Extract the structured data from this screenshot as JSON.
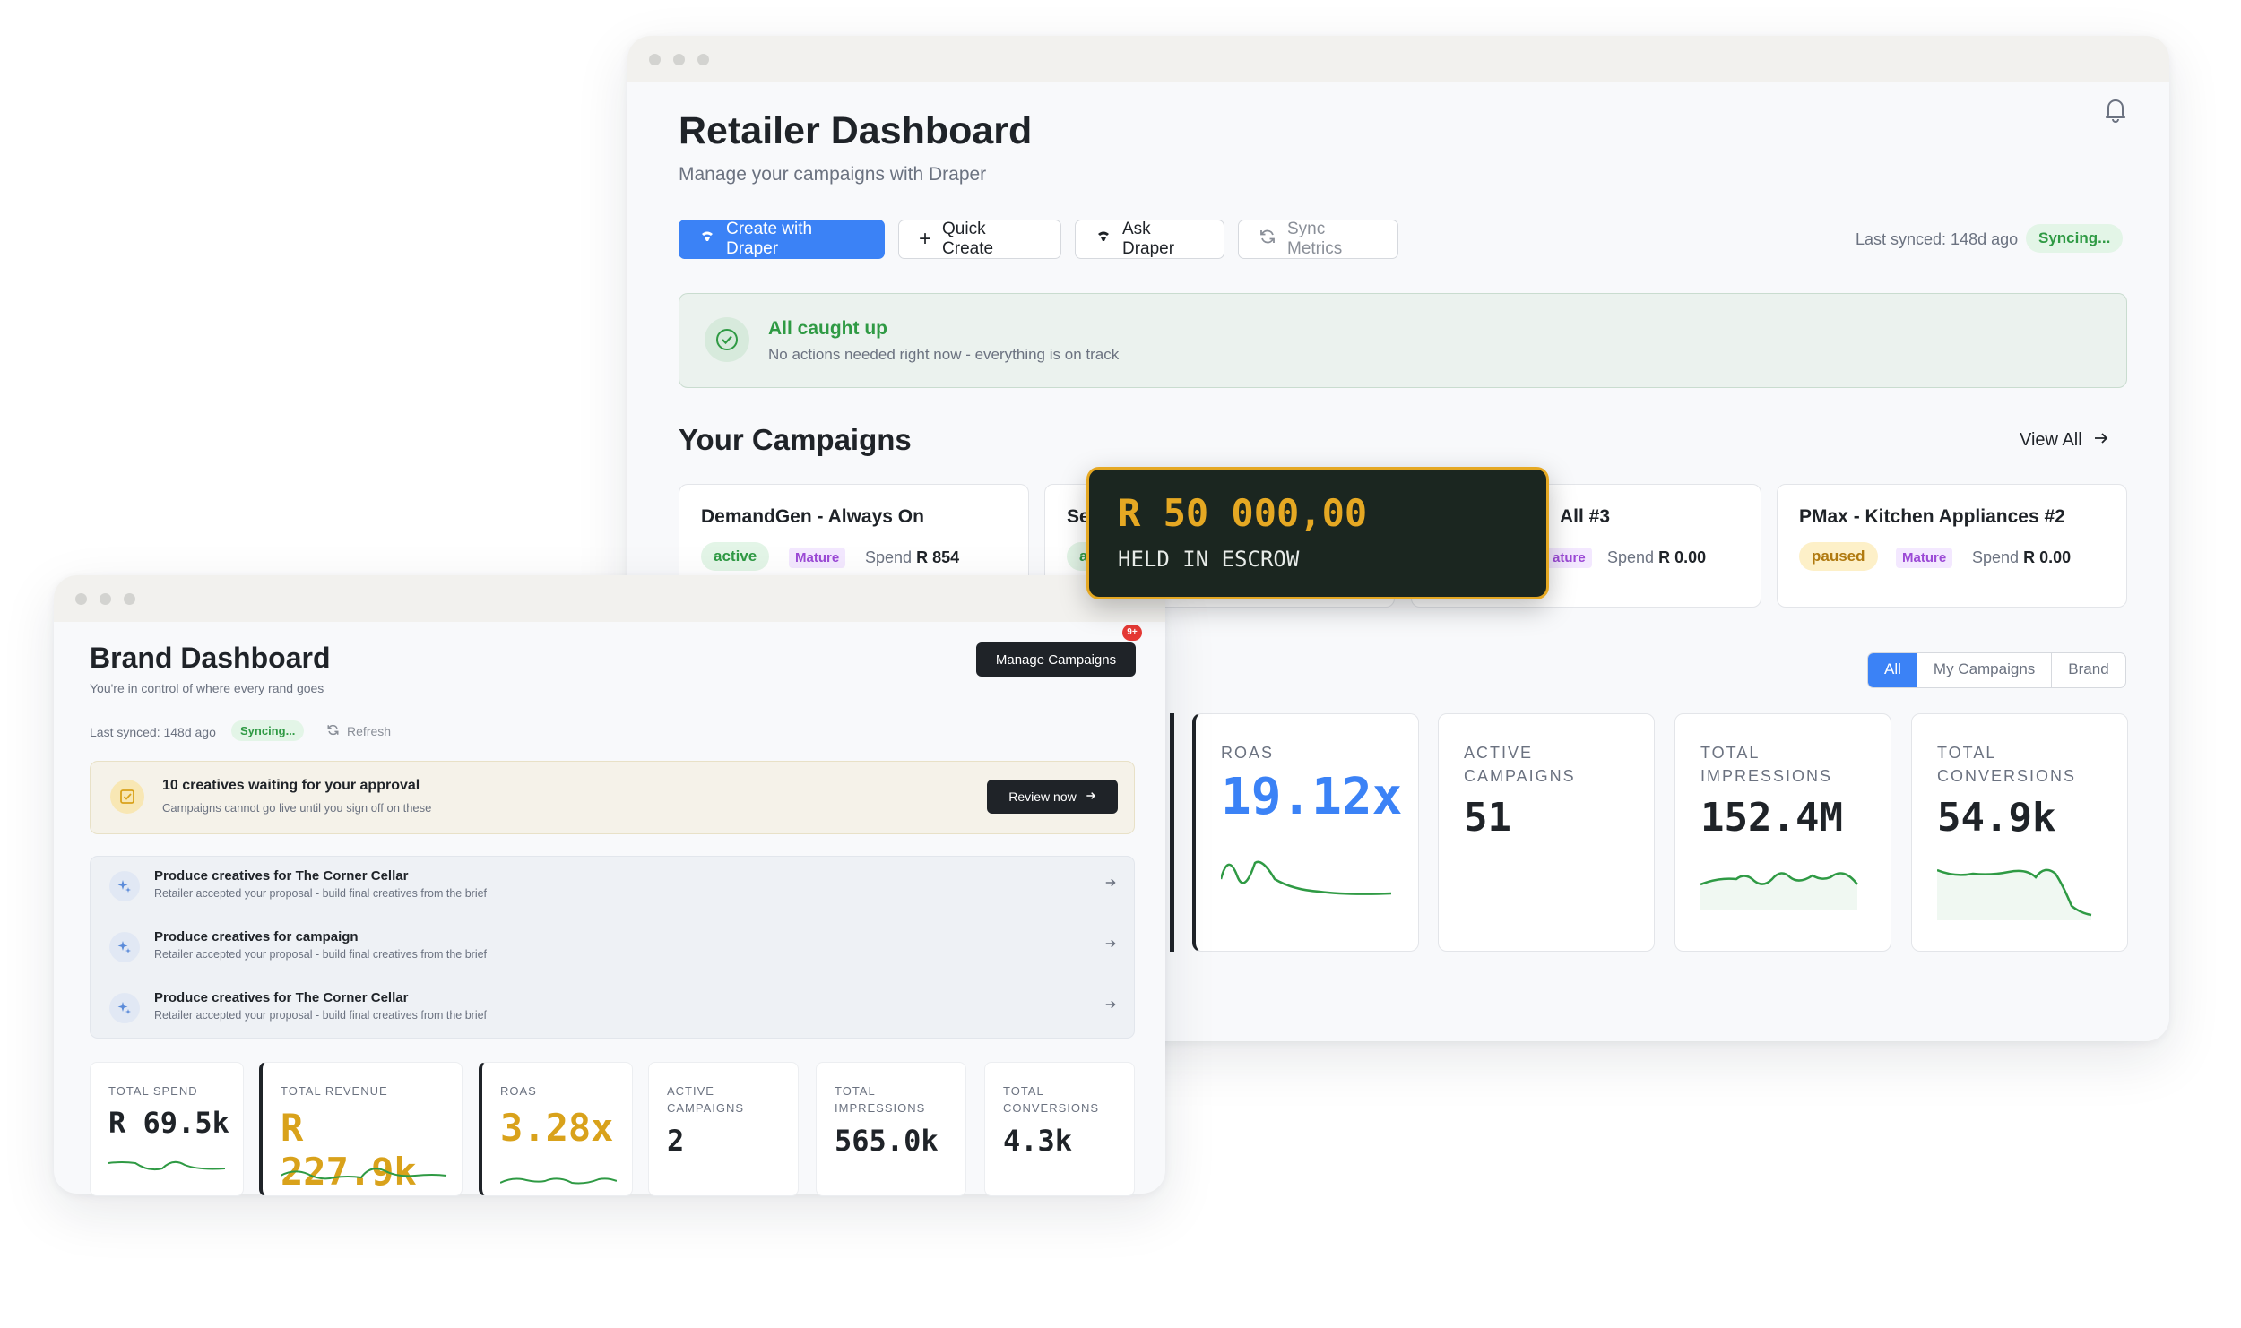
{
  "retailer": {
    "title": "Retailer Dashboard",
    "subtitle": "Manage your campaigns with Draper",
    "buttons": {
      "create": "Create with Draper",
      "quick_create": "Quick Create",
      "ask": "Ask Draper",
      "sync": "Sync Metrics"
    },
    "last_synced": "Last synced: 148d ago",
    "sync_status": "Syncing...",
    "alert": {
      "title": "All caught up",
      "text": "No actions needed right now - everything is on track"
    },
    "campaigns_heading": "Your Campaigns",
    "view_all": "View All",
    "campaigns": [
      {
        "name": "DemandGen - Always On",
        "status": "active",
        "tag": "Mature",
        "spend_label": "Spend",
        "spend": "R 854"
      },
      {
        "name": "Se",
        "status": "a",
        "tag": "",
        "spend_label": "",
        "spend": ""
      },
      {
        "name": "All #3",
        "status": "",
        "tag": "ature",
        "spend_label": "Spend",
        "spend": "R 0.00"
      },
      {
        "name": "PMax - Kitchen Appliances #2",
        "status": "paused",
        "tag": "Mature",
        "spend_label": "Spend",
        "spend": "R 0.00"
      }
    ],
    "filters": [
      "All",
      "My Campaigns",
      "Brand"
    ],
    "stats": [
      {
        "label": "ROAS",
        "value": "19.12x"
      },
      {
        "label": "ACTIVE CAMPAIGNS",
        "value": "51"
      },
      {
        "label": "TOTAL IMPRESSIONS",
        "value": "152.4M"
      },
      {
        "label": "TOTAL CONVERSIONS",
        "value": "54.9k"
      }
    ]
  },
  "escrow": {
    "amount": "R 50 000,00",
    "label": "HELD IN ESCROW"
  },
  "brand": {
    "title": "Brand Dashboard",
    "subtitle": "You're in control of where every rand goes",
    "manage_button": "Manage Campaigns",
    "badge": "9+",
    "last_synced": "Last synced: 148d ago",
    "sync_status": "Syncing...",
    "refresh": "Refresh",
    "approval": {
      "title": "10 creatives waiting for your approval",
      "text": "Campaigns cannot go live until you sign off on these",
      "button": "Review now"
    },
    "tasks": [
      {
        "title": "Produce creatives for The Corner Cellar",
        "text": "Retailer accepted your proposal - build final creatives from the brief"
      },
      {
        "title": "Produce creatives for campaign",
        "text": "Retailer accepted your proposal - build final creatives from the brief"
      },
      {
        "title": "Produce creatives for The Corner Cellar",
        "text": "Retailer accepted your proposal - build final creatives from the brief"
      }
    ],
    "stats": [
      {
        "label": "TOTAL SPEND",
        "value": "R 69.5k"
      },
      {
        "label": "TOTAL REVENUE",
        "value": "R 227.9k"
      },
      {
        "label": "ROAS",
        "value": "3.28x"
      },
      {
        "label": "ACTIVE CAMPAIGNS",
        "value": "2"
      },
      {
        "label": "TOTAL IMPRESSIONS",
        "value": "565.0k"
      },
      {
        "label": "TOTAL CONVERSIONS",
        "value": "4.3k"
      }
    ]
  },
  "colors": {
    "primary": "#3b82f6",
    "success": "#2f9a44",
    "gold": "#d9a21b",
    "dark": "#1b2620"
  }
}
